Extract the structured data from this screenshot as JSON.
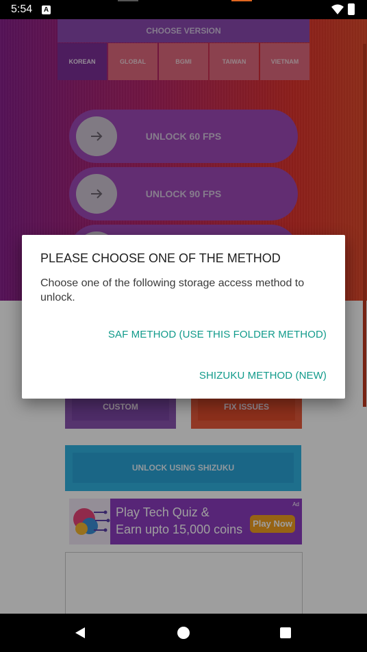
{
  "status_bar": {
    "time": "5:54",
    "notification_icon": "a-icon",
    "wifi_icon": "wifi-icon",
    "battery_icon": "battery-charging-icon"
  },
  "version_selector": {
    "title": "CHOOSE VERSION",
    "tabs": [
      "KOREAN",
      "GLOBAL",
      "BGMI",
      "TAIWAN",
      "VIETNAM"
    ],
    "selected": "KOREAN"
  },
  "unlock_buttons": [
    {
      "label": "UNLOCK 60 FPS",
      "icon": "arrow-right-icon"
    },
    {
      "label": "UNLOCK 90 FPS",
      "icon": "arrow-right-icon"
    }
  ],
  "actions": {
    "custom": "CUSTOM",
    "fix_issues": "FIX ISSUES",
    "shizuku": "UNLOCK USING SHIZUKU"
  },
  "ad": {
    "line1": "Play Tech Quiz &",
    "line2": "Earn upto 15,000 coins",
    "cta": "Play Now",
    "tag": "Ad"
  },
  "dialog": {
    "title": "PLEASE CHOOSE ONE OF THE METHOD",
    "message": "Choose one of the following storage access method to unlock.",
    "option_saf": "SAF METHOD (USE THIS FOLDER METHOD)",
    "option_shizuku": "SHIZUKU METHOD (NEW)"
  },
  "nav_bar": {
    "back": "back-icon",
    "home": "home-icon",
    "recents": "recents-icon"
  },
  "colors": {
    "accent": "#109a8a",
    "hero_start": "#8a1f8e",
    "hero_end": "#e44a2a",
    "shizuku_button": "#31b3e3"
  }
}
